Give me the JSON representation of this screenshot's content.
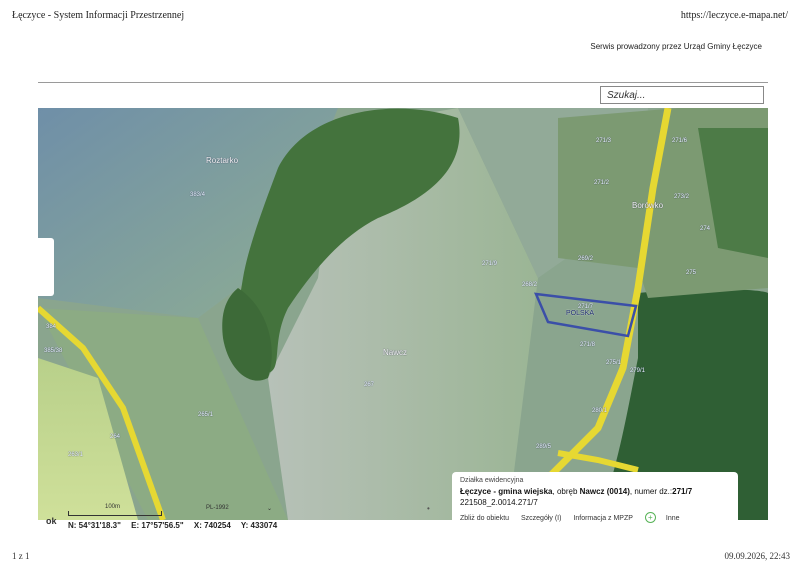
{
  "header": {
    "title": "Łęczyce - System Informacji Przestrzennej",
    "url": "https://leczyce.e-mapa.net/",
    "service_note": "Serwis prowadzony przez Urząd Gminy Łęczyce"
  },
  "search": {
    "placeholder": "Szukaj..."
  },
  "map": {
    "place_labels": [
      "Roztarko",
      "Nawcz",
      "Borówko"
    ],
    "parcel_labels": [
      "383/4",
      "271/9",
      "271/3",
      "271/6",
      "271/2",
      "274",
      "273/2",
      "269/2",
      "268/2",
      "275",
      "271/7",
      "271/8",
      "275/1",
      "279/1",
      "280/1",
      "384",
      "385/38",
      "267",
      "265/1",
      "264",
      "263/1",
      "289/5"
    ],
    "selected_parcel_label": "POLSKA",
    "scale_label": "100m",
    "crs_label": "PL-1992",
    "coords": {
      "n": "N: 54°31'18.3\"",
      "e": "E: 17°57'56.5\"",
      "x": "X: 740254",
      "y": "Y: 433074"
    },
    "ok_label": "ok"
  },
  "panel": {
    "heading": "Działka ewidencyjna",
    "place": "Łęczyce - gmina wiejska",
    "middle": ", obręb ",
    "precinct": "Nawcz (0014)",
    "num_prefix": ", numer dz.:",
    "number": "271/7",
    "identifier": "221508_2.0014.271/7",
    "links": [
      "Zbliż do obiektu",
      "Szczegóły (I)",
      "Informacja z MPZP",
      "Inne"
    ]
  },
  "footer": {
    "page": "1 z 1",
    "datetime": "09.09.2026, 22:43"
  },
  "colors": {
    "road": "#e6d832",
    "parcel_outline": "#3b4fa8",
    "forest": "#3d6e3a",
    "field": "#8aa98a"
  }
}
